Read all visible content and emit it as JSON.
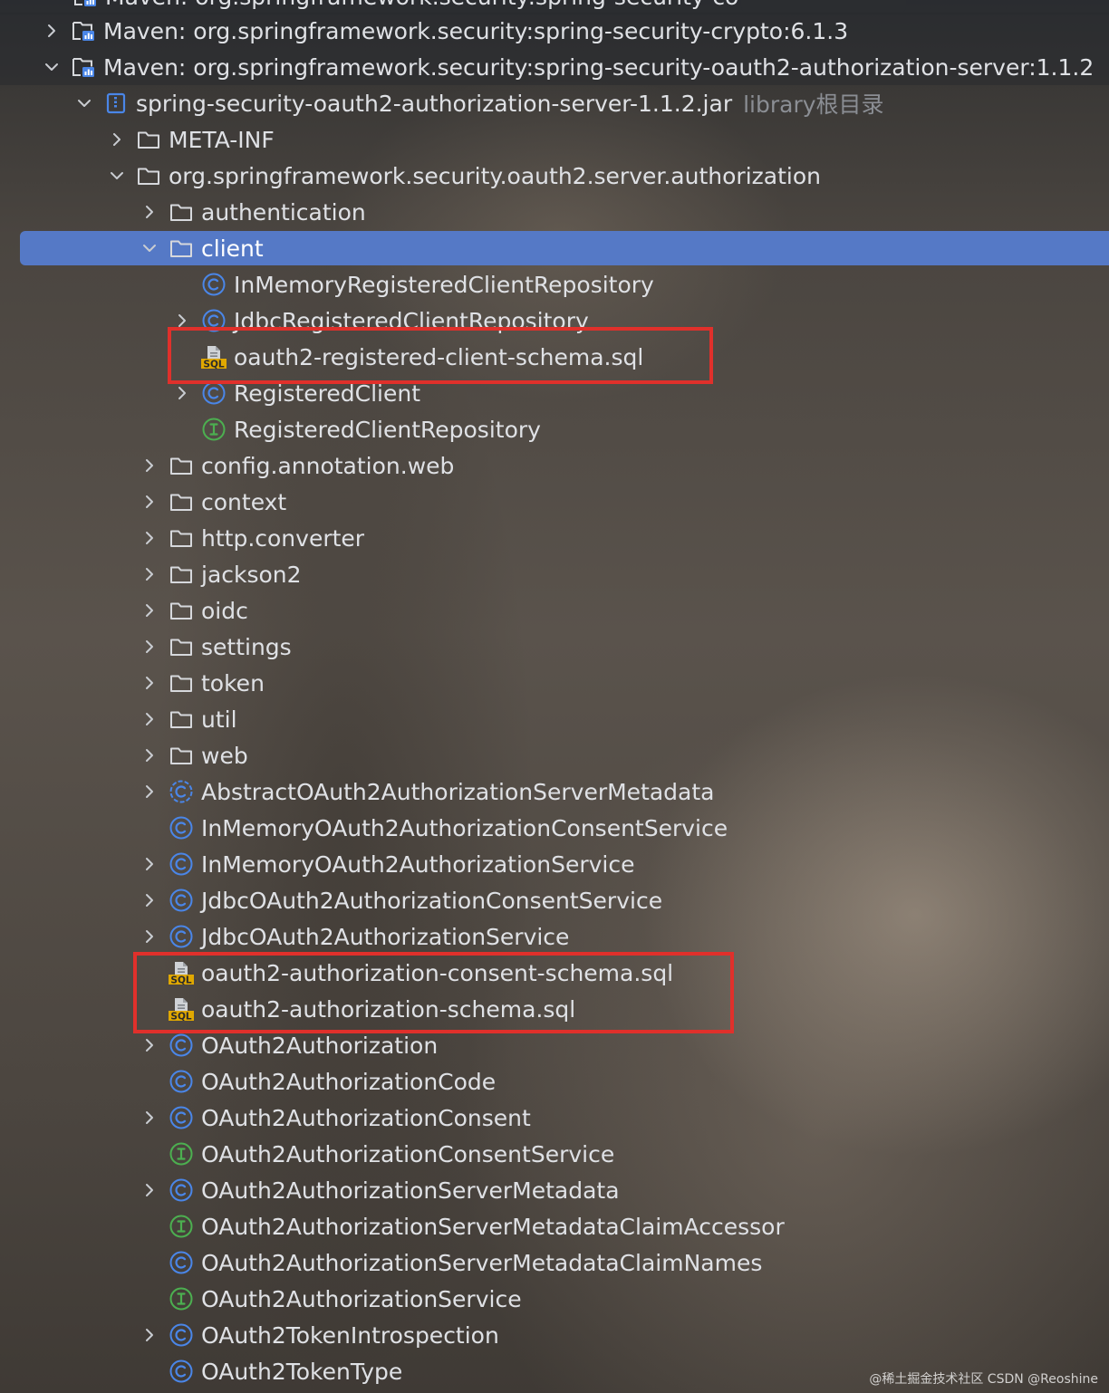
{
  "tree": {
    "partial_row": "Maven: org.springframework.security:spring-security-co",
    "items": [
      {
        "label": "Maven: org.springframework.security:spring-security-crypto:6.1.3",
        "icon": "library-icon",
        "expanded": false,
        "has_children": true
      },
      {
        "label": "Maven: org.springframework.security:spring-security-oauth2-authorization-server:1.1.2",
        "icon": "library-icon",
        "expanded": true,
        "has_children": true
      },
      {
        "label": "spring-security-oauth2-authorization-server-1.1.2.jar",
        "hint": "library根目录",
        "icon": "jar-icon",
        "expanded": true,
        "has_children": true
      },
      {
        "label": "META-INF",
        "icon": "folder-icon",
        "expanded": false,
        "has_children": true
      },
      {
        "label": "org.springframework.security.oauth2.server.authorization",
        "icon": "folder-icon",
        "expanded": true,
        "has_children": true
      },
      {
        "label": "authentication",
        "icon": "folder-icon",
        "expanded": false,
        "has_children": true
      },
      {
        "label": "client",
        "icon": "folder-icon",
        "expanded": true,
        "has_children": true,
        "selected": true
      },
      {
        "label": "InMemoryRegisteredClientRepository",
        "icon": "class-icon",
        "has_children": false
      },
      {
        "label": "JdbcRegisteredClientRepository",
        "icon": "class-icon",
        "has_children": true
      },
      {
        "label": "oauth2-registered-client-schema.sql",
        "icon": "sql-file-icon",
        "has_children": false
      },
      {
        "label": "RegisteredClient",
        "icon": "class-icon",
        "has_children": true
      },
      {
        "label": "RegisteredClientRepository",
        "icon": "interface-icon",
        "has_children": false
      },
      {
        "label": "config.annotation.web",
        "icon": "folder-icon",
        "has_children": true
      },
      {
        "label": "context",
        "icon": "folder-icon",
        "has_children": true
      },
      {
        "label": "http.converter",
        "icon": "folder-icon",
        "has_children": true
      },
      {
        "label": "jackson2",
        "icon": "folder-icon",
        "has_children": true
      },
      {
        "label": "oidc",
        "icon": "folder-icon",
        "has_children": true
      },
      {
        "label": "settings",
        "icon": "folder-icon",
        "has_children": true
      },
      {
        "label": "token",
        "icon": "folder-icon",
        "has_children": true
      },
      {
        "label": "util",
        "icon": "folder-icon",
        "has_children": true
      },
      {
        "label": "web",
        "icon": "folder-icon",
        "has_children": true
      },
      {
        "label": "AbstractOAuth2AuthorizationServerMetadata",
        "icon": "abstract-class-icon",
        "has_children": true
      },
      {
        "label": "InMemoryOAuth2AuthorizationConsentService",
        "icon": "class-icon",
        "has_children": false
      },
      {
        "label": "InMemoryOAuth2AuthorizationService",
        "icon": "class-icon",
        "has_children": true
      },
      {
        "label": "JdbcOAuth2AuthorizationConsentService",
        "icon": "class-icon",
        "has_children": true
      },
      {
        "label": "JdbcOAuth2AuthorizationService",
        "icon": "class-icon",
        "has_children": true
      },
      {
        "label": "oauth2-authorization-consent-schema.sql",
        "icon": "sql-file-icon",
        "has_children": false
      },
      {
        "label": "oauth2-authorization-schema.sql",
        "icon": "sql-file-icon",
        "has_children": false
      },
      {
        "label": "OAuth2Authorization",
        "icon": "class-icon",
        "has_children": true
      },
      {
        "label": "OAuth2AuthorizationCode",
        "icon": "class-icon",
        "has_children": false
      },
      {
        "label": "OAuth2AuthorizationConsent",
        "icon": "class-icon",
        "has_children": true
      },
      {
        "label": "OAuth2AuthorizationConsentService",
        "icon": "interface-icon",
        "has_children": false
      },
      {
        "label": "OAuth2AuthorizationServerMetadata",
        "icon": "class-icon",
        "has_children": true
      },
      {
        "label": "OAuth2AuthorizationServerMetadataClaimAccessor",
        "icon": "interface-icon",
        "has_children": false
      },
      {
        "label": "OAuth2AuthorizationServerMetadataClaimNames",
        "icon": "class-icon",
        "has_children": false
      },
      {
        "label": "OAuth2AuthorizationService",
        "icon": "interface-icon",
        "has_children": false
      },
      {
        "label": "OAuth2TokenIntrospection",
        "icon": "class-icon",
        "has_children": true
      },
      {
        "label": "OAuth2TokenType",
        "icon": "class-icon",
        "has_children": false
      }
    ]
  },
  "watermark": "@稀土掘金技术社区 CSDN @Reoshine",
  "colors": {
    "selection": "#5579c6",
    "highlight_box": "#e0302b",
    "class_icon": "#4a86e8",
    "interface_icon": "#4caf50",
    "sql_badge": "#e0a800",
    "text": "#dfe1e5"
  }
}
